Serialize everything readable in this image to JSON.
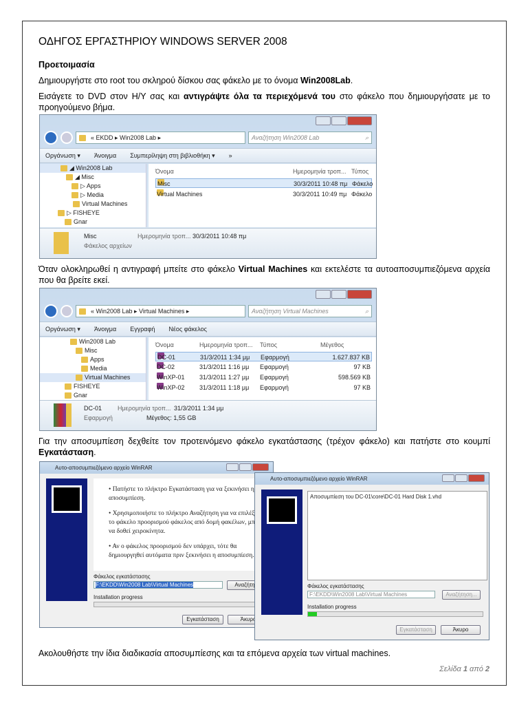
{
  "title": "ΟΔΗΓΟΣ ΕΡΓΑΣΤΗΡΙΟΥ WINDOWS SERVER 2008",
  "section": "Προετοιμασία",
  "p1": {
    "a": "Δημιουργήστε στο root του σκληρού δίσκου σας φάκελο με το όνομα ",
    "b": "Win2008Lab",
    "c": "."
  },
  "p2": {
    "a": "Εισάγετε το DVD στον Η/Υ σας και ",
    "b": "αντιγράψτε όλα τα περιεχόμενά του",
    "c": " στο φάκελο που δημιουργήσατε με το προηγούμενο βήμα."
  },
  "p3": {
    "a": "Όταν ολοκληρωθεί η αντιγραφή μπείτε στο φάκελο ",
    "b": "Virtual Machines",
    "c": " και εκτελέστε τα αυτοαποσυμπιεζόμενα αρχεία που θα βρείτε εκεί."
  },
  "p4": {
    "a": "Για την αποσυμπίεση δεχθείτε τον προτεινόμενο φάκελο εγκατάστασης (τρέχον φάκελο) και πατήστε στο κουμπί ",
    "b": "Εγκατάσταση",
    "c": "."
  },
  "p5": "Ακολουθήστε την ίδια διαδικασία αποσυμπίεσης και τα επόμενα αρχεία των virtual machines.",
  "footer": {
    "a": "Σελίδα ",
    "n": "1",
    "b": " από ",
    "t": "2"
  },
  "explorer1": {
    "address": "« EKDD ▸ Win2008 Lab ▸",
    "search": "Αναζήτηση Win2008 Lab",
    "toolbar": [
      "Οργάνωση ▾",
      "Άνοιγμα",
      "Συμπερίληψη στη βιβλιοθήκη ▾",
      "»"
    ],
    "tree": [
      "◢ Win2008 Lab",
      "◢ Misc",
      "▷ Apps",
      "▷ Media",
      "Virtual Machines",
      "▷ FISHEYE",
      "Gnar"
    ],
    "columns": [
      "Όνομα",
      "Ημερομηνία τροπ...",
      "Τύπος"
    ],
    "rows": [
      {
        "name": "Misc",
        "date": "30/3/2011 10:48 πμ",
        "type": "Φάκελο"
      },
      {
        "name": "Virtual Machines",
        "date": "30/3/2011 10:49 πμ",
        "type": "Φάκελο"
      }
    ],
    "details": {
      "name": "Misc",
      "label": "Ημερομηνία τροπ...",
      "date": "30/3/2011 10:48 πμ",
      "type": "Φάκελος αρχείων"
    }
  },
  "explorer2": {
    "address": "« Win2008 Lab ▸ Virtual Machines ▸",
    "search": "Αναζήτηση Virtual Machines",
    "toolbar": [
      "Οργάνωση ▾",
      "Άνοιγμα",
      "Εγγραφή",
      "Νέος φάκελος"
    ],
    "tree": [
      "Win2008 Lab",
      "Misc",
      "Apps",
      "Media",
      "Virtual Machines",
      "FISHEYE",
      "Gnar"
    ],
    "columns": [
      "Όνομα",
      "Ημερομηνία τροπ...",
      "Τύπος",
      "Μέγεθος"
    ],
    "rows": [
      {
        "name": "DC-01",
        "date": "31/3/2011 1:34 μμ",
        "type": "Εφαρμογή",
        "size": "1.627.837 KB"
      },
      {
        "name": "DC-02",
        "date": "31/3/2011 1:16 μμ",
        "type": "Εφαρμογή",
        "size": "97 KB"
      },
      {
        "name": "WinXP-01",
        "date": "31/3/2011 1:27 μμ",
        "type": "Εφαρμογή",
        "size": "598.569 KB"
      },
      {
        "name": "WinXP-02",
        "date": "31/3/2011 1:18 μμ",
        "type": "Εφαρμογή",
        "size": "97 KB"
      }
    ],
    "details": {
      "name": "DC-01",
      "label": "Ημερομηνία τροπ...",
      "date": "31/3/2011 1:34 μμ",
      "type": "Εφαρμογή",
      "size": "Μέγεθος: 1,55 GB"
    }
  },
  "dialog1": {
    "title": "Αυτο-αποσυμπιεζόμενο αρχείο WinRAR",
    "bullets": [
      "Πατήστε το πλήκτρο Εγκατάσταση για να ξεκινήσει η αποσυμπίεση.",
      "Χρησιμοποιήστε το πλήκτρο Αναζήτηση για να επιλέξετε το φάκελο προορισμού φάκελος από δομή φακέλων, μπορεί να δοθεί χειροκίνητα.",
      "Αν ο φάκελος προορισμού δεν υπάρχει, τότε θα δημιουργηθεί αυτόματα πριν ξεκινήσει η αποσυμπίεση."
    ],
    "folder_label": "Φάκελος εγκατάστασης",
    "folder": "F:\\EKDD\\Win2008 Lab\\Virtual Machines",
    "browse": "Αναζήτηση...",
    "progress_label": "Installation progress",
    "progress": 0,
    "install": "Εγκατάσταση",
    "cancel": "Άκυρο"
  },
  "dialog2": {
    "title": "Αυτο-αποσυμπιεζόμενο αρχείο WinRAR",
    "log": "Αποσυμπίεση του DC-01\\core\\DC-01 Hard Disk 1.vhd",
    "folder_label": "Φάκελος εγκατάστασης",
    "folder": "F:\\EKDD\\Win2008 Lab\\Virtual Machines",
    "browse": "Αναζήτηση...",
    "progress_label": "Installation progress",
    "progress": 0.05,
    "install": "Εγκατάσταση",
    "cancel": "Άκυρο"
  }
}
